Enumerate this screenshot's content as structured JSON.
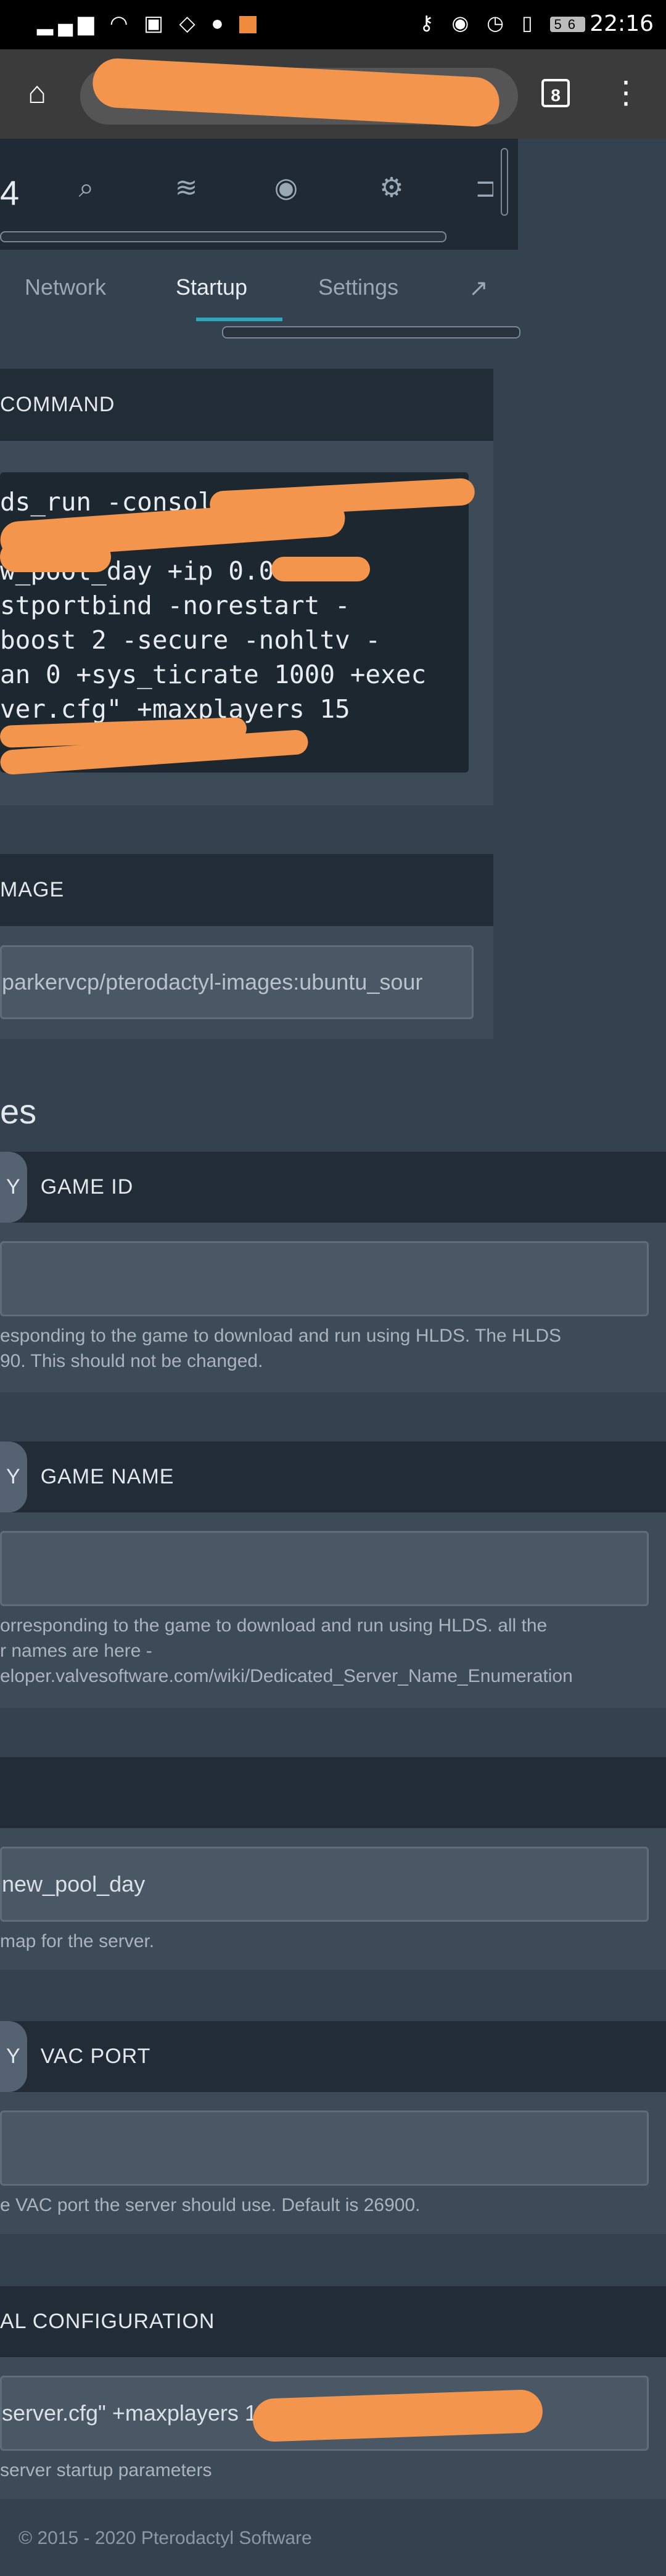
{
  "status_bar": {
    "time": "22:16",
    "battery": "56",
    "left_icons": [
      "signal-icon",
      "signal-icon",
      "wifi-icon",
      "lock-icon",
      "shield-icon",
      "phone-icon",
      "app-icon"
    ],
    "right_icons": [
      "key-icon",
      "eye-icon",
      "alarm-icon",
      "vibrate-icon",
      "battery-icon"
    ]
  },
  "browser": {
    "tab_count": "8"
  },
  "server_nav": {
    "title_fragment": "4",
    "icons": [
      "search-icon",
      "layers-icon",
      "user-icon",
      "cogs-icon",
      "more-icon"
    ]
  },
  "subtabs": {
    "items": [
      "Network",
      "Startup",
      "Settings"
    ],
    "active": "Startup"
  },
  "command_panel": {
    "header": "COMMAND",
    "lines": [
      "ds_run -console",
      "",
      "w_pool_day +ip 0.0.0.0 -",
      "stportbind -norestart -",
      "boost 2 -secure -nohltv -",
      "an 0 +sys_ticrate 1000 +exec",
      "ver.cfg\" +maxplayers 15",
      ""
    ]
  },
  "image_panel": {
    "header": "MAGE",
    "value": "parkervcp/pterodactyl-images:ubuntu_sour"
  },
  "variables_heading": "es",
  "variables": [
    {
      "badge": "Y",
      "header": "GAME ID",
      "value": "",
      "help": [
        "esponding to the game to download and run using HLDS. The HLDS",
        "90. This should not be changed."
      ]
    },
    {
      "badge": "Y",
      "header": "GAME NAME",
      "value": "",
      "help": [
        "orresponding to the game to download and run using HLDS. all the",
        "r names are here -",
        "eloper.valvesoftware.com/wiki/Dedicated_Server_Name_Enumeration"
      ]
    },
    {
      "badge": "",
      "header": "",
      "value": "new_pool_day",
      "help": [
        "map for the server."
      ]
    },
    {
      "badge": "Y",
      "header": "VAC PORT",
      "value": "",
      "help": [
        "e VAC port the server should use. Default is 26900."
      ]
    },
    {
      "badge": "",
      "header": "AL CONFIGURATION",
      "value": "server.cfg\" +maxplayers 15 +",
      "help": [
        "server startup parameters"
      ]
    }
  ],
  "footer": "© 2015 - 2020 Pterodactyl Software",
  "colors": {
    "accent": "#2fa6bd",
    "background": "#34414f",
    "panel_header": "#222c36",
    "redaction": "#f3954c"
  }
}
